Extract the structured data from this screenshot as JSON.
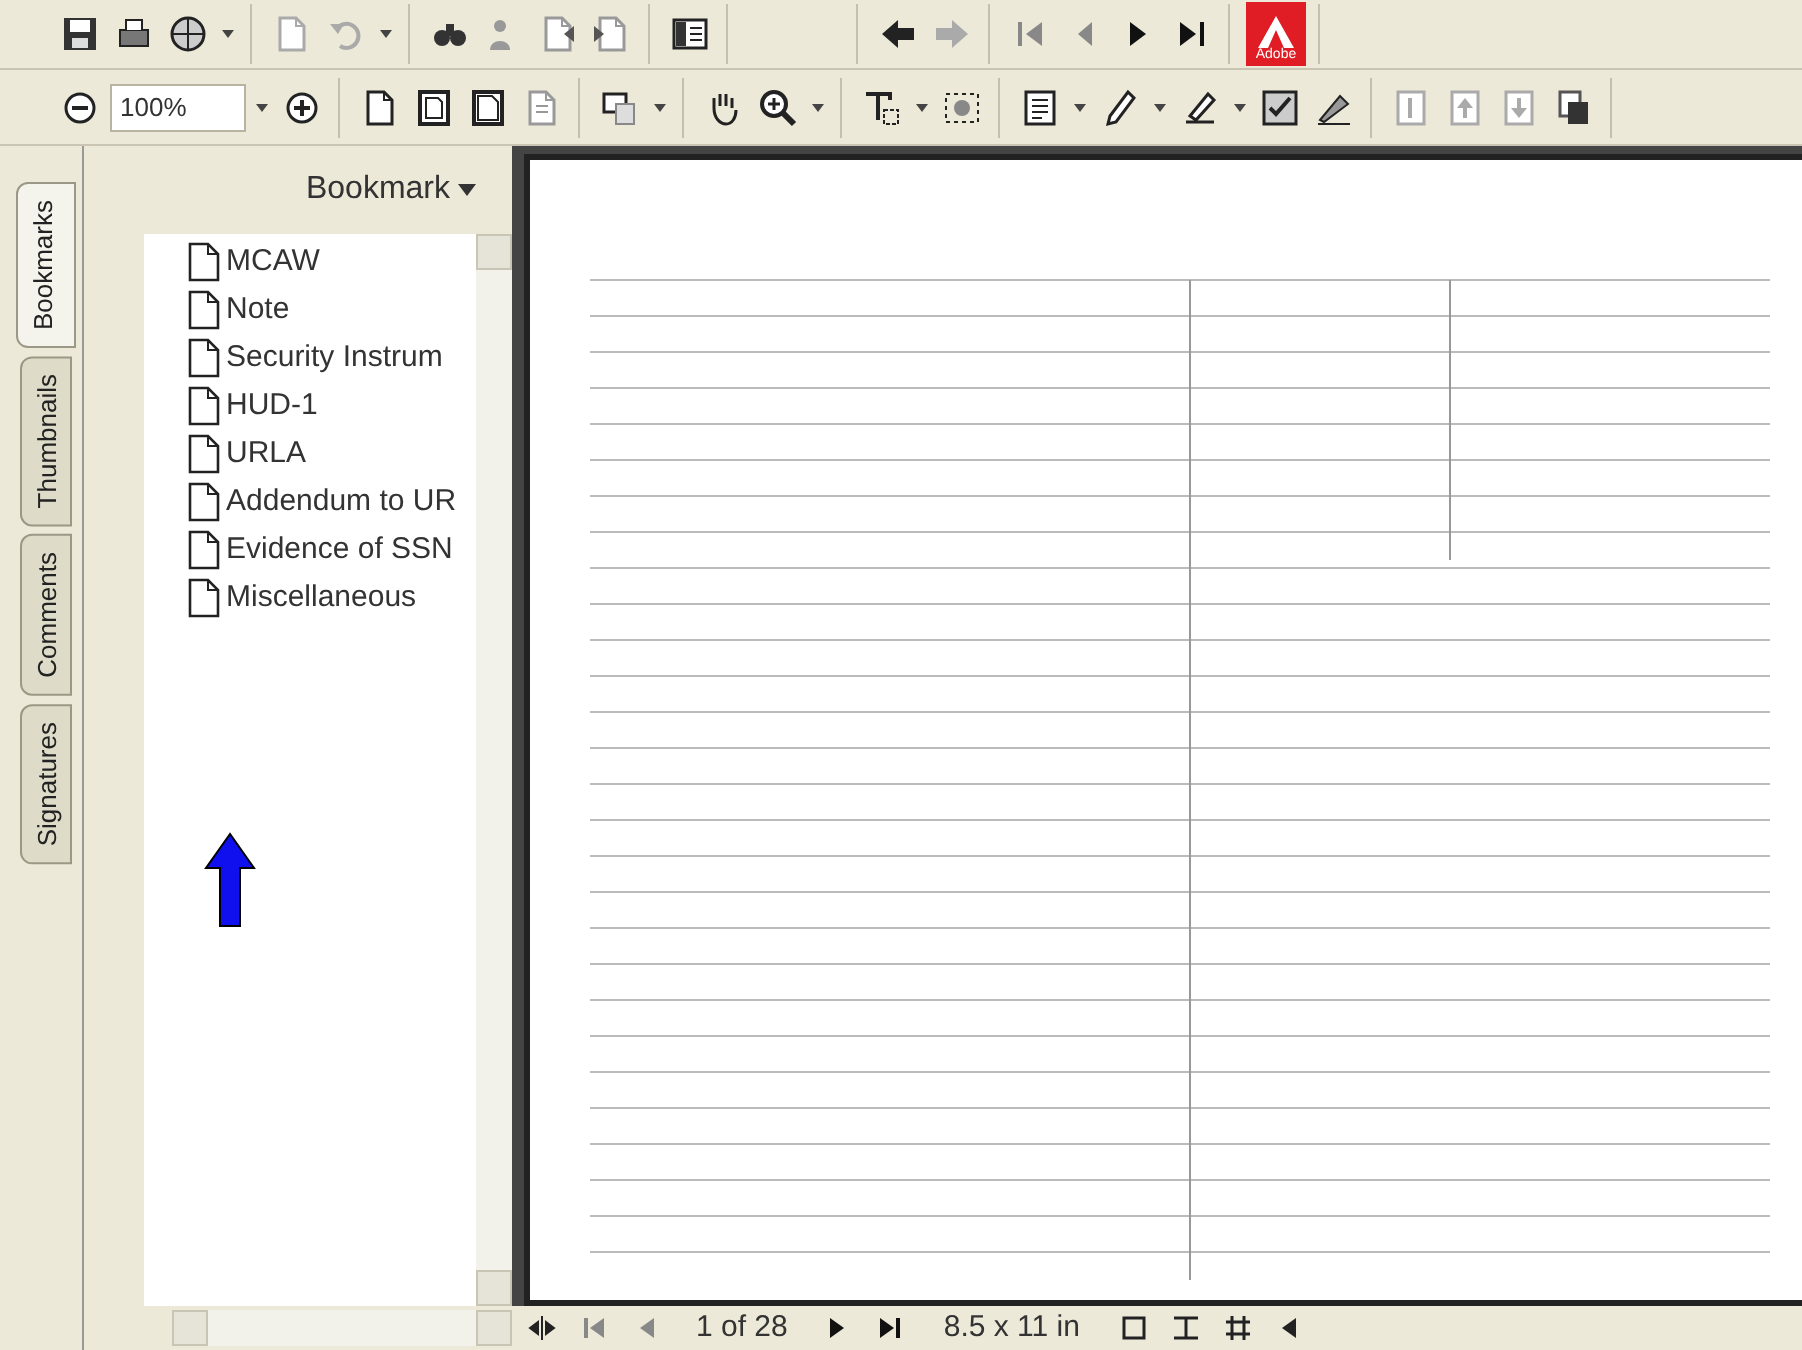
{
  "toolbar": {
    "zoom_value": "100%",
    "logo_text": "Adobe"
  },
  "side_tabs": [
    {
      "label": "Bookmarks",
      "selected": true
    },
    {
      "label": "Thumbnails",
      "selected": false
    },
    {
      "label": "Comments",
      "selected": false
    },
    {
      "label": "Signatures",
      "selected": false
    }
  ],
  "bookmarks_panel": {
    "menu_label": "Bookmark",
    "items": [
      {
        "label": "MCAW"
      },
      {
        "label": "Note"
      },
      {
        "label": "Security Instrum"
      },
      {
        "label": "HUD-1"
      },
      {
        "label": "URLA"
      },
      {
        "label": "Addendum to UR"
      },
      {
        "label": "Evidence of SSN"
      },
      {
        "label": "Miscellaneous"
      }
    ]
  },
  "status_bar": {
    "page": "1 of 28",
    "page_size": "8.5 x 11 in"
  }
}
